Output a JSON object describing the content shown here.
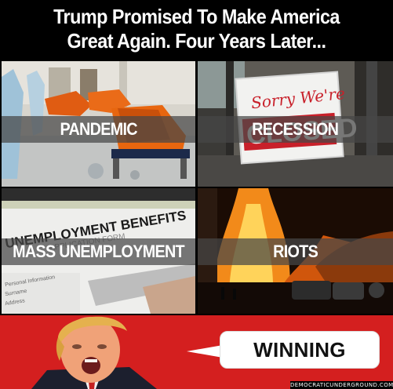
{
  "header": {
    "line1": "Trump Promised To Make America",
    "line2": "Great Again. Four Years Later..."
  },
  "panels": [
    {
      "label": "PANDEMIC"
    },
    {
      "label": "RECESSION",
      "sign_script": "Sorry We're",
      "sign_block": "CLOSED"
    },
    {
      "label": "MASS UNEMPLOYMENT",
      "form_title": "UNEMPLOYMENT BENEFITS",
      "form_sub": "APPLICATION FORM",
      "form_field1": "Personal Information",
      "form_field2": "Surname",
      "form_field3": "Address"
    },
    {
      "label": "RIOTS"
    }
  ],
  "bubble": {
    "text": "WINNING"
  },
  "credit": "DEMOCRATICUNDERGROUND.COM",
  "colors": {
    "bottom_bg": "#d41f1f",
    "band": "rgba(70,70,70,0.72)",
    "sign_red": "#c8202a"
  }
}
